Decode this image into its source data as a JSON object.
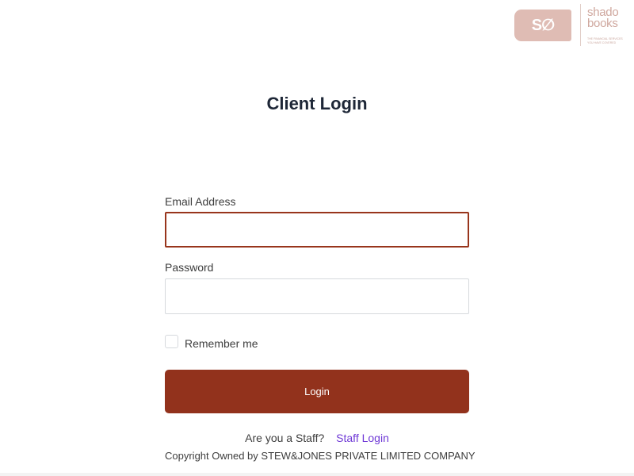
{
  "brand": {
    "badge_text": "S∅",
    "wordmark_line1": "shado",
    "wordmark_line2": "books",
    "tagline_line1": "THE FINANCIAL SERVICES",
    "tagline_line2": "YOU HAVE COVERED",
    "colors": {
      "badge": "#dfbcb4",
      "wordmark": "#cfa79e"
    }
  },
  "page": {
    "title": "Client Login"
  },
  "form": {
    "email_label": "Email Address",
    "email_value": "",
    "email_placeholder": "",
    "password_label": "Password",
    "password_value": "",
    "password_placeholder": "",
    "remember_label": "Remember me",
    "remember_checked": false,
    "login_label": "Login"
  },
  "footer": {
    "staff_question": "Are you a Staff?",
    "staff_link": "Staff Login",
    "copyright": "Copyright Owned by STEW&JONES PRIVATE LIMITED COMPANY"
  },
  "colors": {
    "primary": "#92321c",
    "focus_border": "#98351c",
    "link": "#6f39d6",
    "title": "#1e2737"
  }
}
